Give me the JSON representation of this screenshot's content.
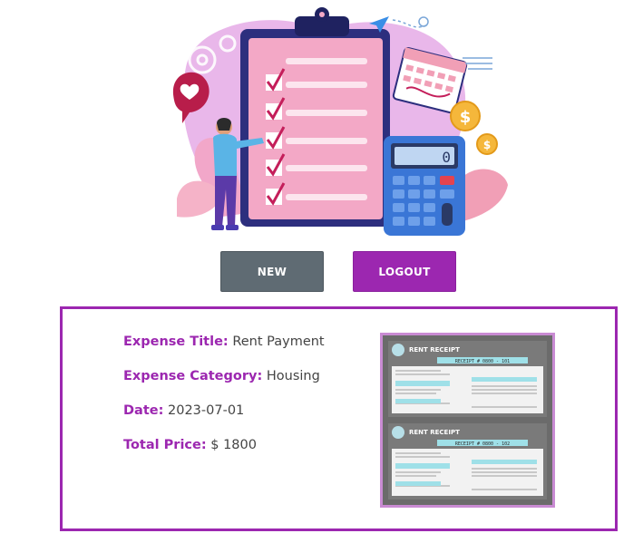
{
  "actions": {
    "new_label": "NEW",
    "logout_label": "LOGOUT"
  },
  "expense": {
    "title_label": "Expense Title:",
    "title_value": "Rent Payment",
    "category_label": "Expense Category:",
    "category_value": "Housing",
    "date_label": "Date:",
    "date_value": "2023-07-01",
    "price_label": "Total Price:",
    "price_value": "$ 1800"
  },
  "receipt_image": {
    "heading": "RENT RECEIPT",
    "receipt_no_1": "RECEIPT # 0800 - 101",
    "receipt_no_2": "RECEIPT # 0800 - 102"
  },
  "calculator_display": "0",
  "colors": {
    "accent": "#9c27b0",
    "secondary_button": "#5f6b73",
    "label": "#9c27b0",
    "value": "#444444"
  },
  "icons": [
    "heart-icon",
    "gear-icon",
    "paper-plane-icon",
    "dollar-coin-icon",
    "checkmark-icon",
    "calculator-icon",
    "calendar-icon",
    "clipboard-icon"
  ]
}
